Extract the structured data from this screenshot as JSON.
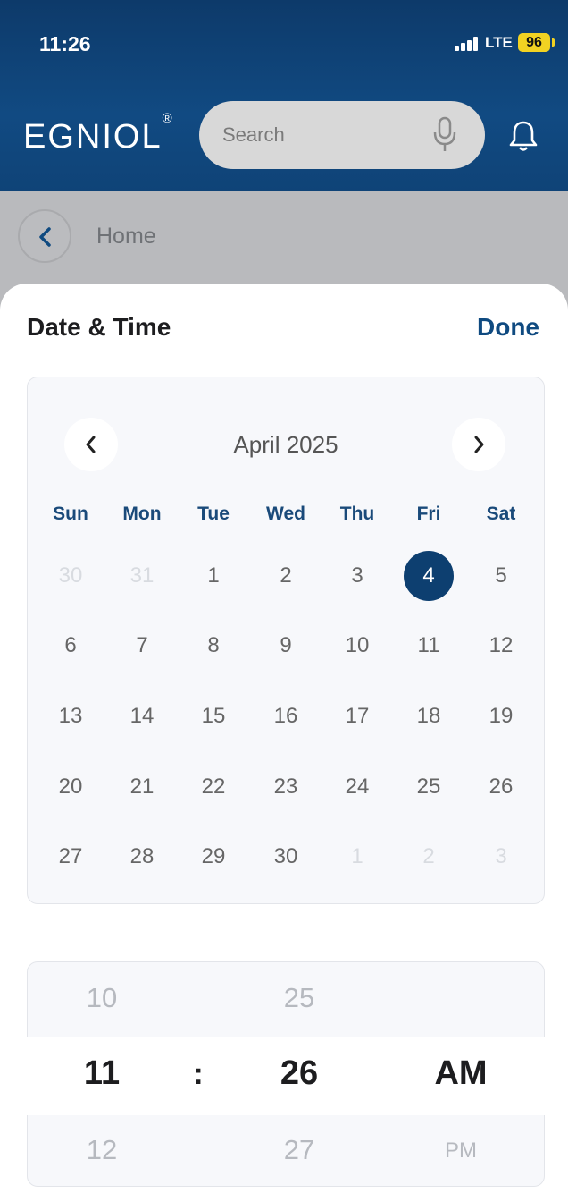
{
  "status": {
    "time": "11:26",
    "network": "LTE",
    "battery": "96"
  },
  "header": {
    "logo": "EGNIOL",
    "logo_mark": "®",
    "search_placeholder": "Search"
  },
  "nav": {
    "breadcrumb": "Home"
  },
  "sheet": {
    "title": "Date & Time",
    "done_label": "Done"
  },
  "calendar": {
    "month_label": "April 2025",
    "weekdays": [
      "Sun",
      "Mon",
      "Tue",
      "Wed",
      "Thu",
      "Fri",
      "Sat"
    ],
    "weeks": [
      [
        "30",
        "31",
        "1",
        "2",
        "3",
        "4",
        "5"
      ],
      [
        "6",
        "7",
        "8",
        "9",
        "10",
        "11",
        "12"
      ],
      [
        "13",
        "14",
        "15",
        "16",
        "17",
        "18",
        "19"
      ],
      [
        "20",
        "21",
        "22",
        "23",
        "24",
        "25",
        "26"
      ],
      [
        "27",
        "28",
        "29",
        "30",
        "1",
        "2",
        "3"
      ]
    ],
    "selected_day": "4"
  },
  "time_picker": {
    "hour_prev": "10",
    "hour": "11",
    "hour_next": "12",
    "separator": ":",
    "minute_prev": "25",
    "minute": "26",
    "minute_next": "27",
    "period": "AM",
    "period_next": "PM"
  },
  "colors": {
    "brand": "#0f4a80",
    "header_bg": "#0d3a6a",
    "selected": "#0d3f70"
  }
}
